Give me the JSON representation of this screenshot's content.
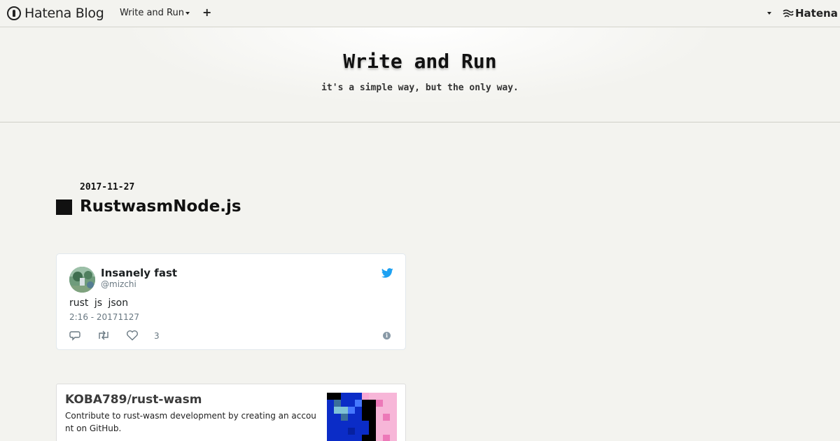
{
  "globalbar": {
    "logo_text": "Hatena Blog",
    "blog_select_label": "Write and Run",
    "plus_label": "+",
    "brand_text": "Hatena"
  },
  "blog": {
    "title": "Write and Run",
    "description": "it's a simple way, but the only way."
  },
  "entry": {
    "date": "2017-11-27",
    "title": "RustwasmNode.js"
  },
  "tweet": {
    "name": "Insanely fast",
    "handle": "@mizchi",
    "text": "rust  js  json",
    "time": "2:16 - 20171127",
    "like_count": "3",
    "info_glyph": "i",
    "accent_color": "#1da1f2"
  },
  "github_card": {
    "title": "KOBA789/rust-wasm",
    "description": "Contribute to rust-wasm development by creating an account on GitHub."
  },
  "icons": [
    "hatena-blog-logo-icon",
    "caret-down-icon",
    "plus-icon",
    "hatena-logo-icon",
    "twitter-bird-icon",
    "reply-icon",
    "retweet-icon",
    "heart-icon",
    "info-icon"
  ]
}
